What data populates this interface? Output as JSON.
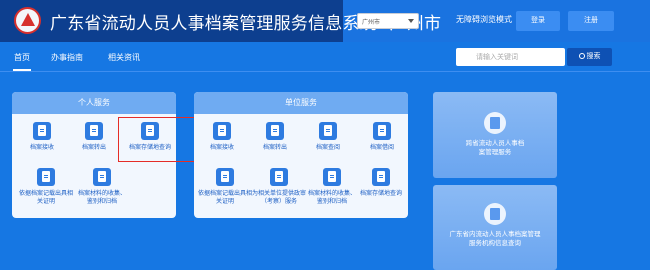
{
  "header": {
    "title": "广东省流动人员人事档案管理服务信息系统",
    "separator": "-",
    "city": "广州市",
    "city_select": "广州市",
    "access_mode": "无障碍浏览模式",
    "login_label": "登录",
    "register_label": "注册"
  },
  "nav": {
    "items": [
      "首页",
      "办事指南",
      "相关资讯"
    ],
    "active": "首页",
    "search_placeholder": "请输入关键词",
    "search_button": "搜索"
  },
  "personal_services": {
    "title": "个人服务",
    "tiles": [
      {
        "label": "档案接收",
        "icon": "document-icon"
      },
      {
        "label": "档案转出",
        "icon": "document-icon"
      },
      {
        "label": "档案存储地查询",
        "icon": "document-search-icon",
        "highlighted": true
      },
      {
        "label": "依据档案记载出具相关证明",
        "icon": "document-icon"
      },
      {
        "label": "档案材料的收集、鉴别和归档",
        "icon": "document-icon"
      }
    ]
  },
  "unit_services": {
    "title": "单位服务",
    "tiles": [
      {
        "label": "档案接收",
        "icon": "document-icon"
      },
      {
        "label": "档案转出",
        "icon": "document-icon"
      },
      {
        "label": "档案查阅",
        "icon": "document-icon"
      },
      {
        "label": "档案借阅",
        "icon": "document-icon"
      },
      {
        "label": "依据档案记载出具相关证明",
        "icon": "document-icon"
      },
      {
        "label": "为相关单位提供政审（考察）服务",
        "icon": "document-icon"
      },
      {
        "label": "档案材料的收集、鉴别和归档",
        "icon": "document-icon"
      },
      {
        "label": "档案存储地查询",
        "icon": "document-icon"
      }
    ]
  },
  "side_cards": [
    {
      "label": "跨省流动人员人事档案管理服务",
      "icon": "transfer-icon"
    },
    {
      "label": "广东省内流动人员人事档案管理服务机构信息查询",
      "icon": "archive-icon"
    }
  ],
  "colors": {
    "header_dark": "#0d3f8f",
    "page_blue": "#1677e3",
    "highlight_red": "#e52d27"
  }
}
